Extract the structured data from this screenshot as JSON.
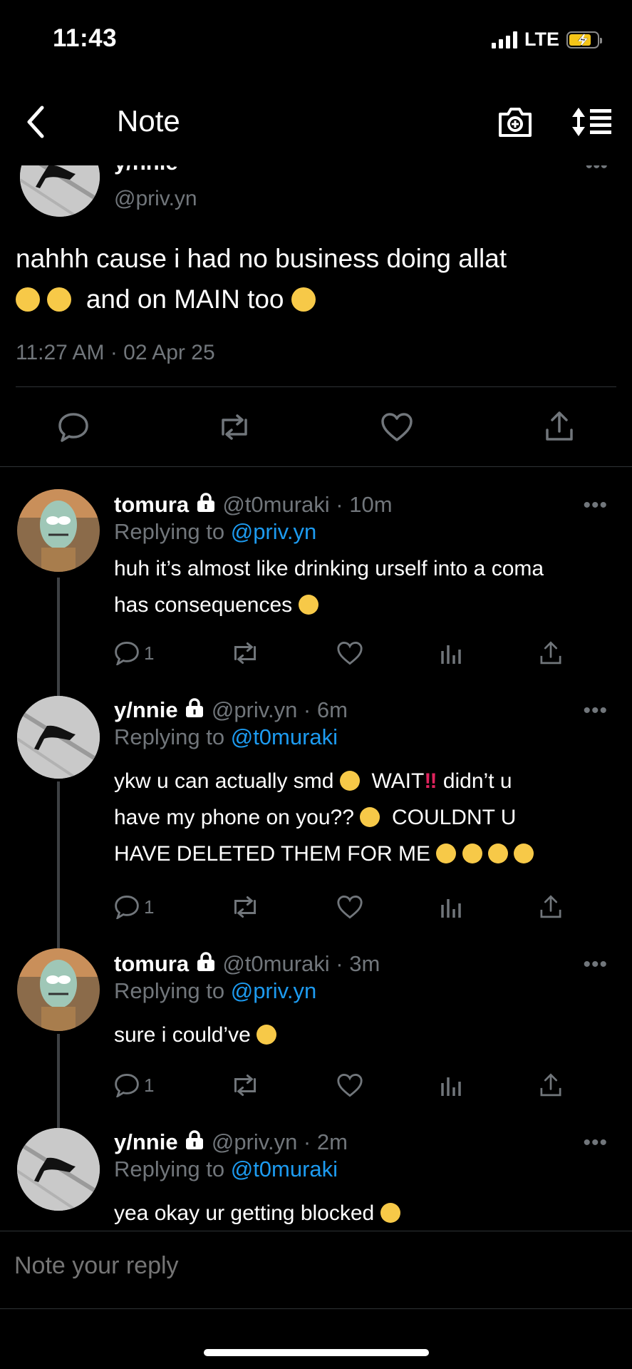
{
  "status_bar": {
    "time": "11:43",
    "network": "LTE"
  },
  "nav": {
    "title": "Note"
  },
  "main_post": {
    "name": "y/nnie",
    "handle": "@priv.yn",
    "text_line1": "nahhh cause i had no business doing allat",
    "text_line2": "and on MAIN too",
    "timestamp": "11:27 AM · 02 Apr 25"
  },
  "replies": [
    {
      "name": "tomura",
      "handle_time": "@t0muraki · 10m",
      "replying_prefix": "Replying to",
      "replying_to": "@priv.yn",
      "line1": "huh it’s almost like drinking urself into a coma",
      "line2": "has consequences",
      "reply_count": "1"
    },
    {
      "name": "y/nnie",
      "handle_time": "@priv.yn · 6m",
      "replying_prefix": "Replying to",
      "replying_to": "@t0muraki",
      "line1a": "ykw u can actually smd",
      "line1b": "WAIT",
      "line1c": "didn’t u",
      "line2a": "have my phone on you??",
      "line2b": "COULDNT U",
      "line3": "HAVE DELETED THEM FOR ME",
      "reply_count": "1"
    },
    {
      "name": "tomura",
      "handle_time": "@t0muraki · 3m",
      "replying_prefix": "Replying to",
      "replying_to": "@priv.yn",
      "line1": "sure i could’ve",
      "reply_count": "1"
    },
    {
      "name": "y/nnie",
      "handle_time": "@priv.yn · 2m",
      "replying_prefix": "Replying to",
      "replying_to": "@t0muraki",
      "line1": "yea okay ur getting blocked"
    }
  ],
  "composer": {
    "placeholder": "Note your reply"
  },
  "colors": {
    "accent": "#1d9bf0",
    "muted": "#71767b",
    "divider": "#2f3336"
  }
}
